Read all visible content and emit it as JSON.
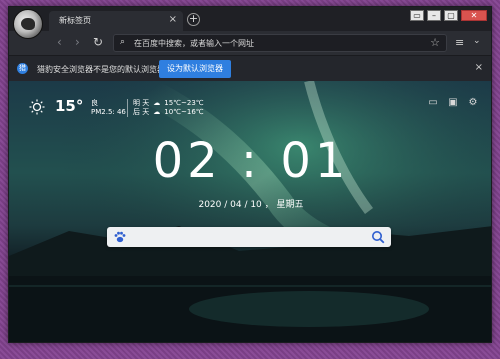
{
  "window": {
    "tab_title": "新标签页",
    "tab_close": "×",
    "new_tab": "+",
    "controls": [
      "▭",
      "–",
      "▢",
      "✕"
    ]
  },
  "toolbar": {
    "back": "‹",
    "forward": "›",
    "reload": "↻",
    "address_placeholder": "在百度中搜索，或者输入一个网址",
    "star": "☆",
    "menu": "≡",
    "chevron": "⌄"
  },
  "notification": {
    "icon": "猎",
    "text": "猎豹安全浏览器不是您的默认浏览器",
    "button_label": "设为默认浏览器",
    "close": "×"
  },
  "weather": {
    "temperature": "15°",
    "condition": "良",
    "pm25": "PM2.5: 46",
    "tomorrow_label": "明 天",
    "tomorrow_range": "15℃~23℃",
    "after_label": "后 天",
    "after_range": "10℃~16℃"
  },
  "clock": {
    "time": "02 : 01",
    "date": "2020 / 04 / 10 ， 星期五"
  },
  "colors": {
    "accent": "#2f7fe0",
    "desktop": "#7a3f86",
    "chrome": "#2b2d33"
  },
  "icons": [
    "logo-icon",
    "sun-icon",
    "cloud-icon",
    "card-icon",
    "image-icon",
    "gear-icon",
    "paw-icon",
    "search-icon"
  ]
}
